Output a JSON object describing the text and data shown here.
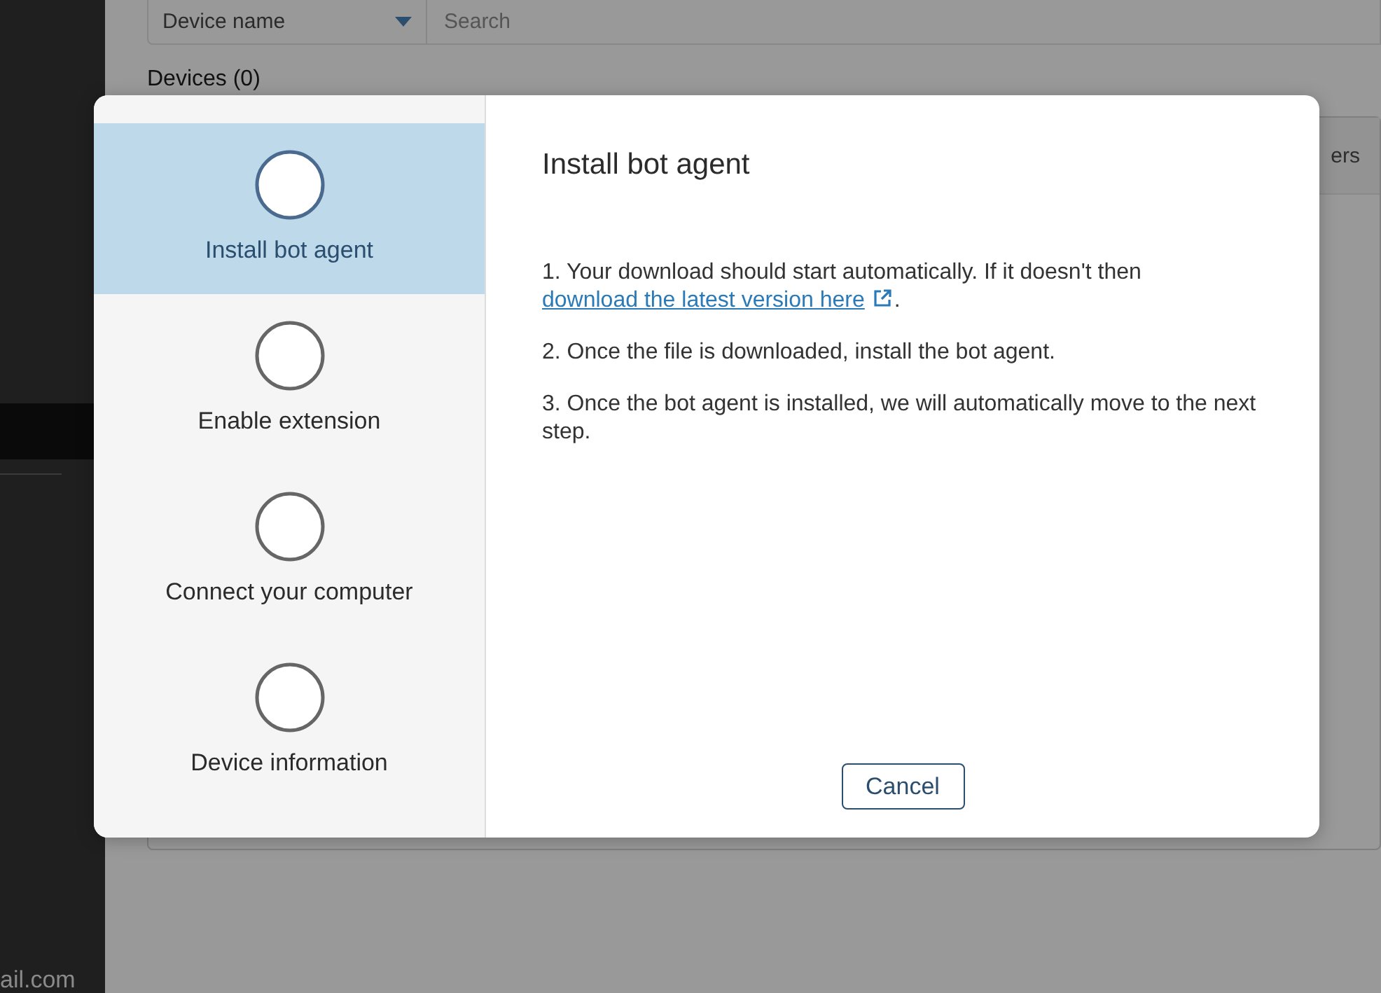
{
  "sidebar": {
    "footer_text": "ail.com"
  },
  "filter": {
    "field": "Device name",
    "search_placeholder": "Search"
  },
  "devices_heading": "Devices (0)",
  "table": {
    "column_partial": "ers"
  },
  "dialog": {
    "steps": [
      {
        "label": "Install bot agent",
        "selected": true
      },
      {
        "label": "Enable extension",
        "selected": false
      },
      {
        "label": "Connect your computer",
        "selected": false
      },
      {
        "label": "Device information",
        "selected": false
      }
    ],
    "title": "Install bot agent",
    "instructions": [
      {
        "text": "1. Your download should start automatically. If it doesn't then ",
        "link": "download the latest version here",
        "after": "."
      },
      {
        "text": "2. Once the file is downloaded, install the bot agent."
      },
      {
        "text": "3. Once the bot agent is installed, we will automatically move to the next step."
      }
    ],
    "cancel": "Cancel"
  }
}
